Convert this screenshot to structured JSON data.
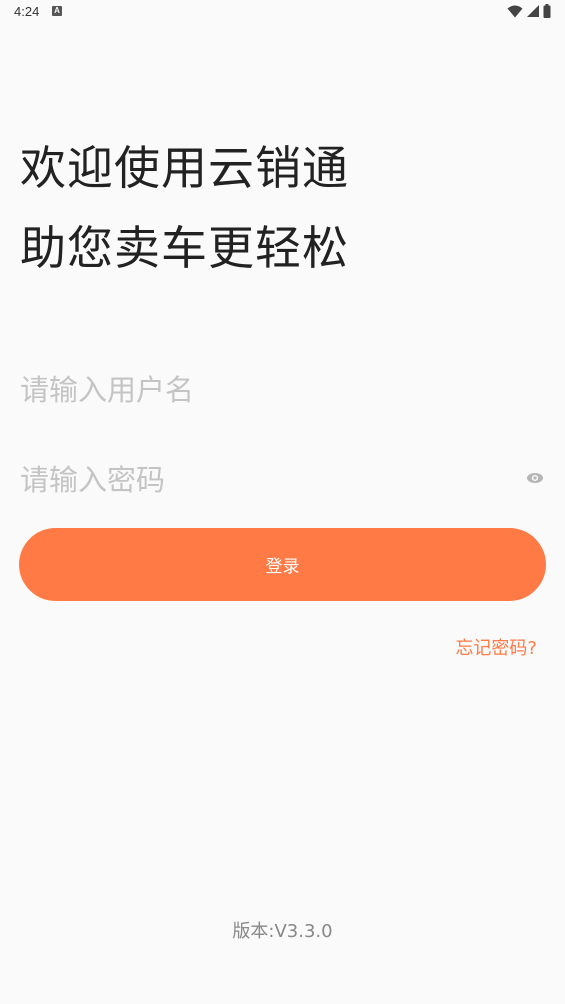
{
  "status_bar": {
    "time": "4:24",
    "notification_icon": "a-icon",
    "icons": [
      "wifi-icon",
      "cell-signal-icon",
      "battery-icon"
    ]
  },
  "headline": {
    "line1": "欢迎使用云销通",
    "line2": "助您卖车更轻松"
  },
  "form": {
    "username_placeholder": "请输入用户名",
    "username_value": "",
    "password_placeholder": "请输入密码",
    "password_value": "",
    "password_toggle_icon": "eye-icon",
    "login_label": "登录",
    "forgot_label": "忘记密码?"
  },
  "footer": {
    "version": "版本:V3.3.0"
  },
  "colors": {
    "accent": "#ff7a45",
    "background": "#fafafa",
    "headline": "#222222",
    "placeholder": "#c4c4c4",
    "version": "#888888"
  }
}
